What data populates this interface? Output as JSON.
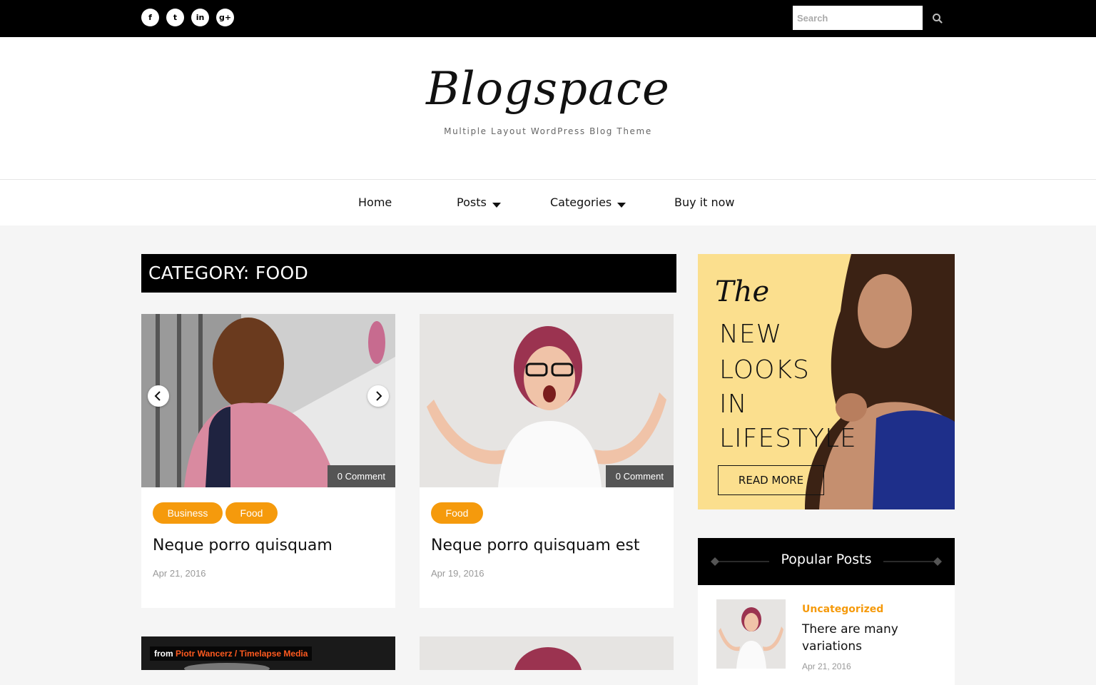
{
  "topbar": {
    "social": [
      {
        "name": "facebook",
        "glyph": "f"
      },
      {
        "name": "twitter",
        "glyph": "t"
      },
      {
        "name": "linkedin",
        "glyph": "in"
      },
      {
        "name": "google-plus",
        "glyph": "g+"
      }
    ],
    "search_placeholder": "Search"
  },
  "header": {
    "logo": "Blogspace",
    "tagline": "Multiple Layout WordPress Blog Theme"
  },
  "nav": {
    "home": "Home",
    "posts": "Posts",
    "categories": "Categories",
    "buy": "Buy it now"
  },
  "category": {
    "title": "CATEGORY: FOOD"
  },
  "posts": [
    {
      "comment": "0 Comment",
      "tags": [
        "Business",
        "Food"
      ],
      "title": "Neque porro quisquam",
      "date": "Apr 21, 2016"
    },
    {
      "comment": "0 Comment",
      "tags": [
        "Food"
      ],
      "title": "Neque porro quisquam est",
      "date": "Apr 19, 2016"
    }
  ],
  "video": {
    "from": "from",
    "credit": "Piotr Wancerz / Timelapse Media"
  },
  "ad": {
    "script": "The",
    "lines": [
      "NEW",
      "LOOKS",
      "IN",
      "LIFESTYLE"
    ],
    "button": "READ MORE"
  },
  "popular": {
    "heading": "Popular Posts",
    "post": {
      "category": "Uncategorized",
      "title": "There are many variations",
      "date": "Apr 21, 2016"
    }
  },
  "colors": {
    "accent": "#f59a0c",
    "dark": "#000000",
    "ad_bg": "#fbdf8e"
  }
}
